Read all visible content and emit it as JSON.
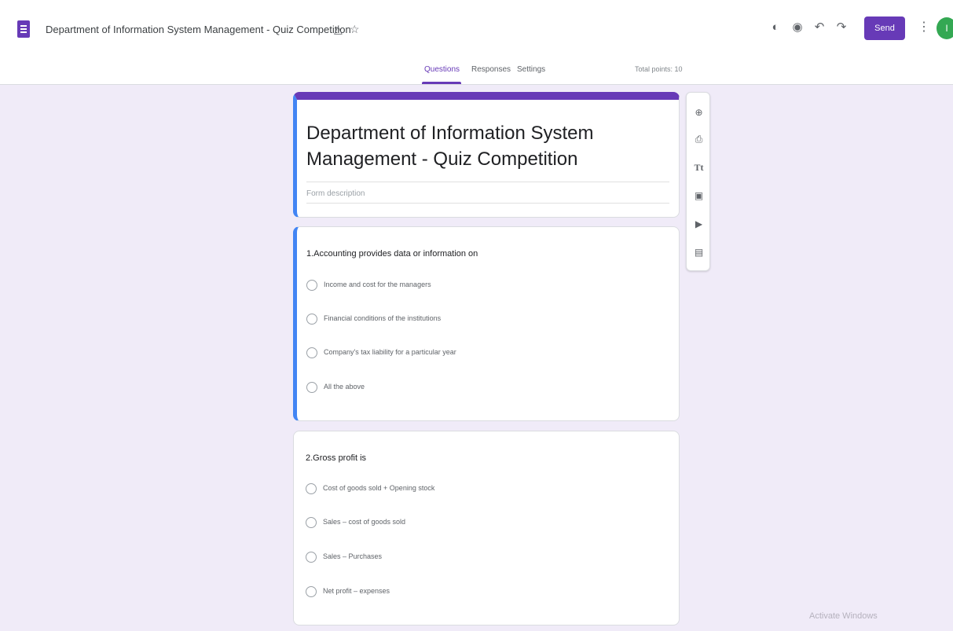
{
  "header": {
    "doc_title": "Department of Information System Management - Quiz Competition",
    "icons": {
      "drive": "drive-move-icon",
      "star": "star-icon",
      "palette": "palette-icon",
      "preview": "preview-eye-icon",
      "undo": "undo-icon",
      "redo": "redo-icon",
      "more": "more-vert-icon"
    },
    "send_label": "Send",
    "avatar_initial": "I"
  },
  "tabs": [
    {
      "label": "Questions",
      "active": true
    },
    {
      "label": "Responses",
      "active": false
    },
    {
      "label": "Settings",
      "active": false
    }
  ],
  "total_points": "Total points: 10",
  "form": {
    "title": "Department of Information System Management - Quiz Competition",
    "description_placeholder": "Form description"
  },
  "questions": [
    {
      "text": "1.Accounting provides data or information on",
      "options": [
        "Income and cost for the managers",
        "Financial conditions of the institutions",
        "Company's tax liability for a particular year",
        "All the above"
      ]
    },
    {
      "text": "2.Gross profit is",
      "options": [
        "Cost of goods sold + Opening stock",
        "Sales – cost of goods sold",
        "Sales – Purchases",
        "Net profit – expenses"
      ]
    }
  ],
  "toolbar": [
    "add-question-icon",
    "import-questions-icon",
    "add-title-icon",
    "add-image-icon",
    "add-video-icon",
    "add-section-icon"
  ],
  "watermark": "Activate Windows",
  "colors": {
    "accent": "#673ab7",
    "active_border": "#4285f4",
    "background": "#f0ebf8",
    "avatar": "#34a853"
  }
}
